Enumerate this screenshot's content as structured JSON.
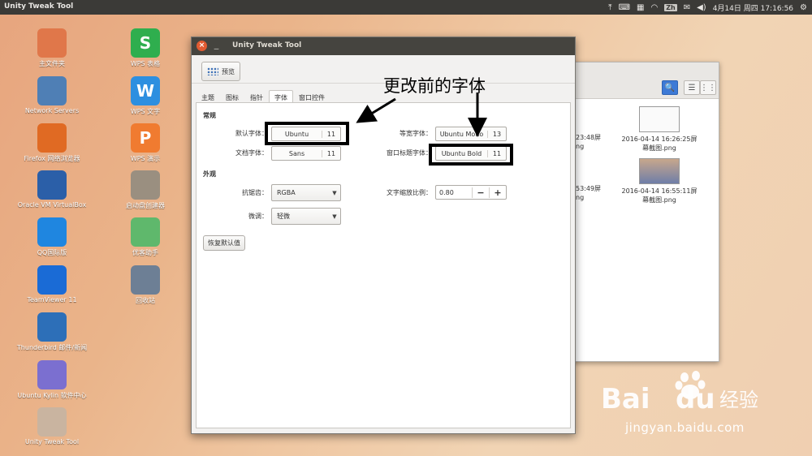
{
  "top_panel": {
    "app_title": "Unity Tweak Tool",
    "ime_label": "Zh",
    "clock": "4月14日 周四 17:16:56"
  },
  "desktop": {
    "icons": [
      {
        "label": "主文件夹",
        "icon": "folder-icon",
        "color": "#e0774a"
      },
      {
        "label": "Network Servers",
        "icon": "network-icon",
        "color": "#4f7fb5"
      },
      {
        "label": "Firefox 网络浏览器",
        "icon": "firefox-icon",
        "color": "#e06a23"
      },
      {
        "label": "Oracle VM VirtualBox",
        "icon": "virtualbox-icon",
        "color": "#2b5fa8"
      },
      {
        "label": "QQ国际版",
        "icon": "qq-icon",
        "color": "#1f86e0"
      },
      {
        "label": "TeamViewer 11",
        "icon": "teamviewer-icon",
        "color": "#1a6bd6"
      },
      {
        "label": "Thunderbird 邮件/新闻",
        "icon": "thunderbird-icon",
        "color": "#2d6fb8"
      },
      {
        "label": "Ubuntu Kylin 软件中心",
        "icon": "kylin-store-icon",
        "color": "#7b6fd0"
      },
      {
        "label": "Unity Tweak Tool",
        "icon": "tweak-tool-icon",
        "color": "#c9b4a0"
      },
      {
        "label": "WPS 表格",
        "icon": "wps-sheet-icon",
        "color": "#2fae4e",
        "glyph": "S"
      },
      {
        "label": "WPS 文字",
        "icon": "wps-writer-icon",
        "color": "#2d8fe0",
        "glyph": "W"
      },
      {
        "label": "WPS 演示",
        "icon": "wps-present-icon",
        "color": "#f07b30",
        "glyph": "P"
      },
      {
        "label": "启动盘创建器",
        "icon": "usb-creator-icon",
        "color": "#9a8f80"
      },
      {
        "label": "优客助手",
        "icon": "youker-assistant-icon",
        "color": "#5fb86c"
      },
      {
        "label": "回收站",
        "icon": "trash-icon",
        "color": "#6d7f95"
      }
    ]
  },
  "file_window": {
    "files": [
      {
        "name_line1": "2016-04-14 16:26:25屏",
        "name_line2": "幕截图.png"
      },
      {
        "name_line1": "2016-04-14 16:55:11屏",
        "name_line2": "幕截图.png"
      }
    ],
    "partial_left": [
      "23:48屏",
      "ng",
      "53:49屏",
      "ng"
    ]
  },
  "tweak_window": {
    "title": "Unity Tweak Tool",
    "preview_label": "预览",
    "tabs": [
      "主题",
      "图标",
      "指针",
      "字体",
      "窗口控件"
    ],
    "active_tab": 3,
    "general_heading": "常规",
    "appearance_heading": "外观",
    "default_font_label": "默认字体：",
    "default_font": {
      "name": "Ubuntu",
      "size": "11"
    },
    "document_font_label": "文档字体：",
    "document_font": {
      "name": "Sans",
      "size": "11"
    },
    "monospace_font_label": "等宽字体：",
    "monospace_font": {
      "name": "Ubuntu Mono",
      "size": "13"
    },
    "titlebar_font_label": "窗口标题字体：",
    "titlebar_font": {
      "name": "Ubuntu Bold",
      "size": "11"
    },
    "antialias_label": "抗锯齿：",
    "antialias_value": "RGBA",
    "hinting_label": "微调：",
    "hinting_value": "轻微",
    "text_scale_label": "文字缩放比例：",
    "text_scale_value": "0.80",
    "reset_label": "恢复默认值"
  },
  "annotation": {
    "text": "更改前的字体"
  },
  "watermark": {
    "brand": "Baidu经验",
    "url": "jingyan.baidu.com"
  }
}
